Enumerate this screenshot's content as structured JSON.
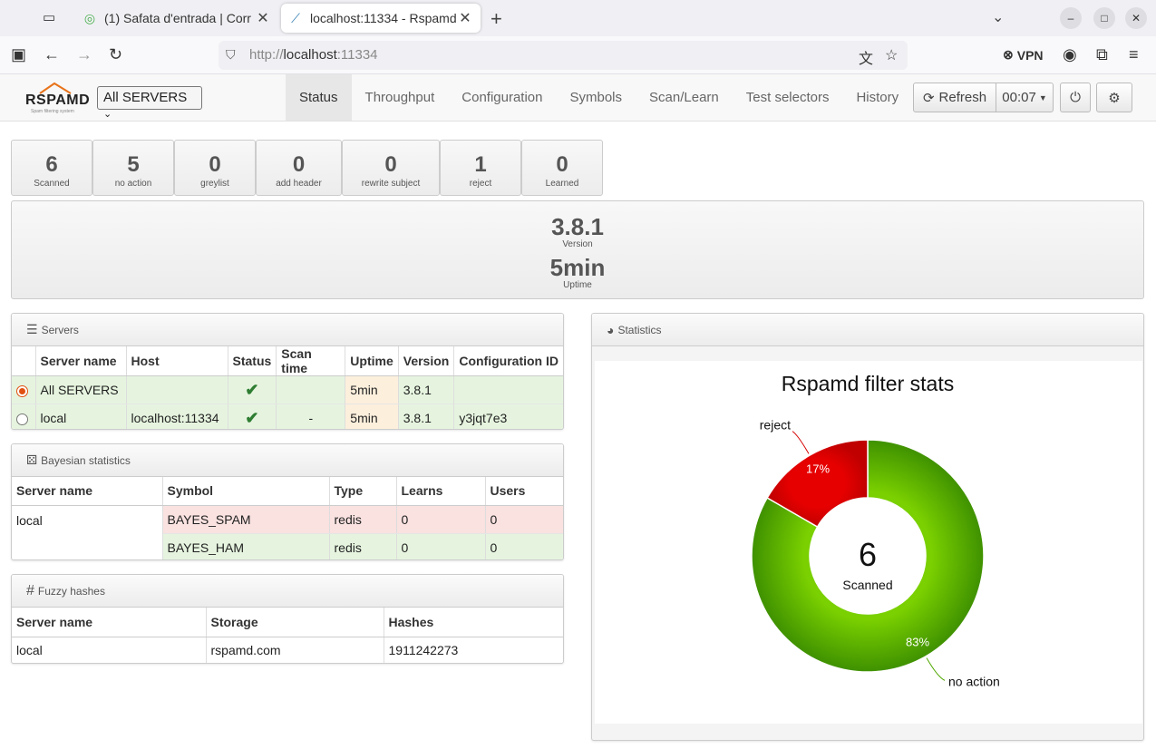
{
  "browser": {
    "tabs": [
      {
        "title": "(1) Safata d'entrada | Corr",
        "active": false
      },
      {
        "title": "localhost:11334 - Rspamd",
        "active": true
      }
    ],
    "url_proto": "http://",
    "url_host": "localhost",
    "url_port": ":11334",
    "vpn_label": "VPN"
  },
  "app": {
    "logo_text": "RSPAMD",
    "logo_sub": "Spam filtering system",
    "server_select": "All SERVERS",
    "menu": [
      "Status",
      "Throughput",
      "Configuration",
      "Symbols",
      "Scan/Learn",
      "Test selectors",
      "History"
    ],
    "active_menu": "Status",
    "refresh_label": "Refresh",
    "timer": "00:07"
  },
  "stats": [
    {
      "value": "6",
      "label": "Scanned"
    },
    {
      "value": "5",
      "label": "no action"
    },
    {
      "value": "0",
      "label": "greylist"
    },
    {
      "value": "0",
      "label": "add header"
    },
    {
      "value": "0",
      "label": "rewrite subject"
    },
    {
      "value": "1",
      "label": "reject"
    },
    {
      "value": "0",
      "label": "Learned"
    }
  ],
  "info": {
    "version": "3.8.1",
    "version_label": "Version",
    "uptime": "5min",
    "uptime_label": "Uptime"
  },
  "servers": {
    "title": "Servers",
    "headers": [
      "Server name",
      "Host",
      "Status",
      "Scan time",
      "Uptime",
      "Version",
      "Configuration ID"
    ],
    "rows": [
      {
        "name": "All SERVERS",
        "host": "",
        "scan": "",
        "uptime": "5min",
        "version": "3.8.1",
        "config": "",
        "selected": true
      },
      {
        "name": "local",
        "host": "localhost:11334",
        "scan": "-",
        "uptime": "5min",
        "version": "3.8.1",
        "config": "y3jqt7e3",
        "selected": false
      }
    ]
  },
  "bayes": {
    "title": "Bayesian statistics",
    "headers": [
      "Server name",
      "Symbol",
      "Type",
      "Learns",
      "Users"
    ],
    "server": "local",
    "rows": [
      {
        "symbol": "BAYES_SPAM",
        "type": "redis",
        "learns": "0",
        "users": "0"
      },
      {
        "symbol": "BAYES_HAM",
        "type": "redis",
        "learns": "0",
        "users": "0"
      }
    ]
  },
  "fuzzy": {
    "title": "Fuzzy hashes",
    "headers": [
      "Server name",
      "Storage",
      "Hashes"
    ],
    "rows": [
      {
        "server": "local",
        "storage": "rspamd.com",
        "hashes": "1911242273"
      }
    ]
  },
  "statistics_title": "Statistics",
  "chart_data": {
    "type": "pie",
    "title": "Rspamd filter stats",
    "center_value": "6",
    "center_label": "Scanned",
    "slices": [
      {
        "label": "no action",
        "value": 5,
        "percent": "83%",
        "color": "#4fa800"
      },
      {
        "label": "reject",
        "value": 1,
        "percent": "17%",
        "color": "#d60000"
      }
    ]
  }
}
